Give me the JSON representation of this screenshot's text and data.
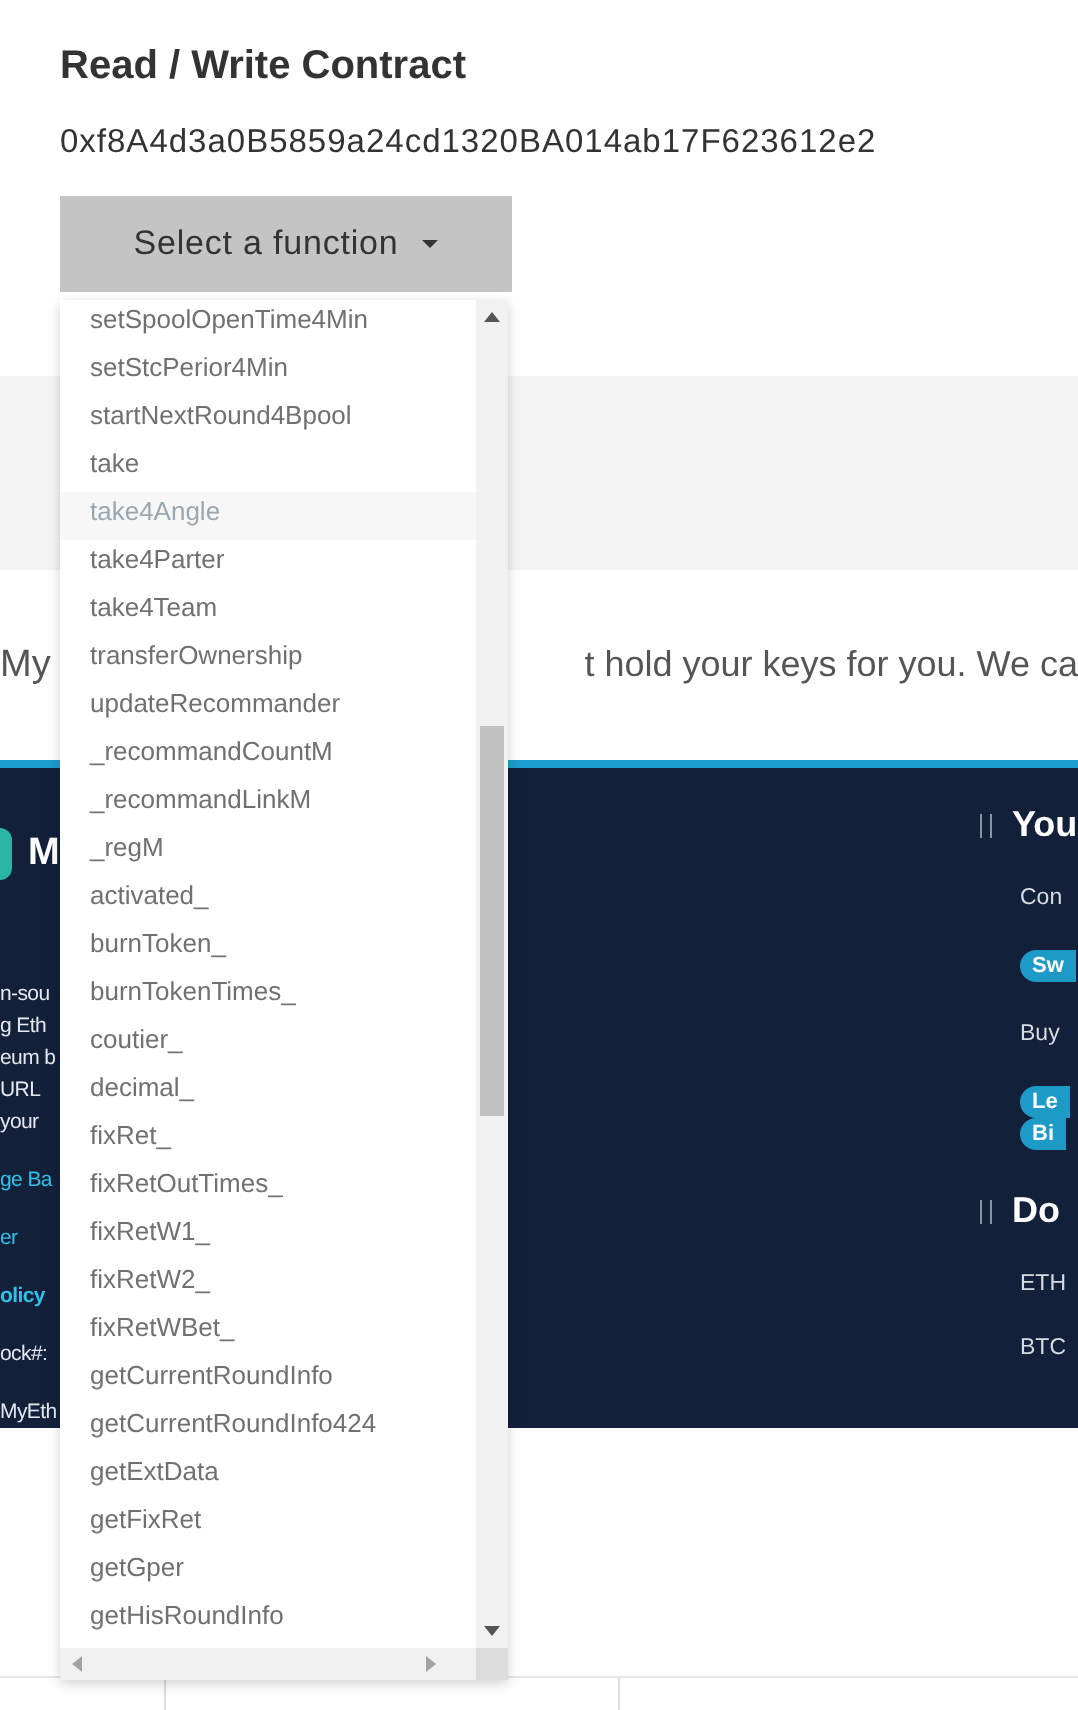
{
  "contract": {
    "title": "Read / Write Contract",
    "address": "0xf8A4d3a0B5859a24cd1320BA014ab17F623612e2",
    "select_button": "Select a function"
  },
  "dropdown": {
    "options": [
      {
        "label": "setSpoolOpenTime4Min",
        "selected": false
      },
      {
        "label": "setStcPerior4Min",
        "selected": false
      },
      {
        "label": "startNextRound4Bpool",
        "selected": false
      },
      {
        "label": "take",
        "selected": false
      },
      {
        "label": "take4Angle",
        "selected": true
      },
      {
        "label": "take4Parter",
        "selected": false
      },
      {
        "label": "take4Team",
        "selected": false
      },
      {
        "label": "transferOwnership",
        "selected": false
      },
      {
        "label": "updateRecommander",
        "selected": false
      },
      {
        "label": "_recommandCountM",
        "selected": false
      },
      {
        "label": "_recommandLinkM",
        "selected": false
      },
      {
        "label": "_regM",
        "selected": false
      },
      {
        "label": "activated_",
        "selected": false
      },
      {
        "label": "burnToken_",
        "selected": false
      },
      {
        "label": "burnTokenTimes_",
        "selected": false
      },
      {
        "label": "coutier_",
        "selected": false
      },
      {
        "label": "decimal_",
        "selected": false
      },
      {
        "label": "fixRet_",
        "selected": false
      },
      {
        "label": "fixRetOutTimes_",
        "selected": false
      },
      {
        "label": "fixRetW1_",
        "selected": false
      },
      {
        "label": "fixRetW2_",
        "selected": false
      },
      {
        "label": "fixRetWBet_",
        "selected": false
      },
      {
        "label": "getCurrentRoundInfo",
        "selected": false
      },
      {
        "label": "getCurrentRoundInfo424",
        "selected": false
      },
      {
        "label": "getExtData",
        "selected": false
      },
      {
        "label": "getFixRet",
        "selected": false
      },
      {
        "label": "getGper",
        "selected": false
      },
      {
        "label": "getHisRoundInfo",
        "selected": false
      }
    ]
  },
  "notice": {
    "left": "My",
    "right": "t hold your keys for you. We ca"
  },
  "footer": {
    "logo_letter": "M",
    "left_items": [
      {
        "kind": "text",
        "text": "n-sou"
      },
      {
        "kind": "text",
        "text": "g Eth"
      },
      {
        "kind": "text",
        "text": "eum b"
      },
      {
        "kind": "text",
        "text": "URL"
      },
      {
        "kind": "text",
        "text": "your"
      },
      {
        "kind": "link",
        "text": "ge Ba"
      },
      {
        "kind": "link",
        "text": "er"
      },
      {
        "kind": "link_bold",
        "text": "olicy"
      },
      {
        "kind": "label",
        "text": "ock#:"
      },
      {
        "kind": "label",
        "text": "MyEth"
      }
    ],
    "right_items": [
      {
        "kind": "heading",
        "texts": [
          "You"
        ]
      },
      {
        "kind": "text",
        "texts": [
          "Con"
        ]
      },
      {
        "kind": "pills",
        "texts": [
          "Sw"
        ]
      },
      {
        "kind": "text",
        "texts": [
          "Buy"
        ]
      },
      {
        "kind": "pills",
        "texts": [
          "Le",
          "Bi"
        ]
      },
      {
        "kind": "heading",
        "texts": [
          "Do"
        ]
      },
      {
        "kind": "text",
        "texts": [
          "ETH"
        ]
      },
      {
        "kind": "text",
        "texts": [
          "BTC"
        ]
      }
    ]
  }
}
